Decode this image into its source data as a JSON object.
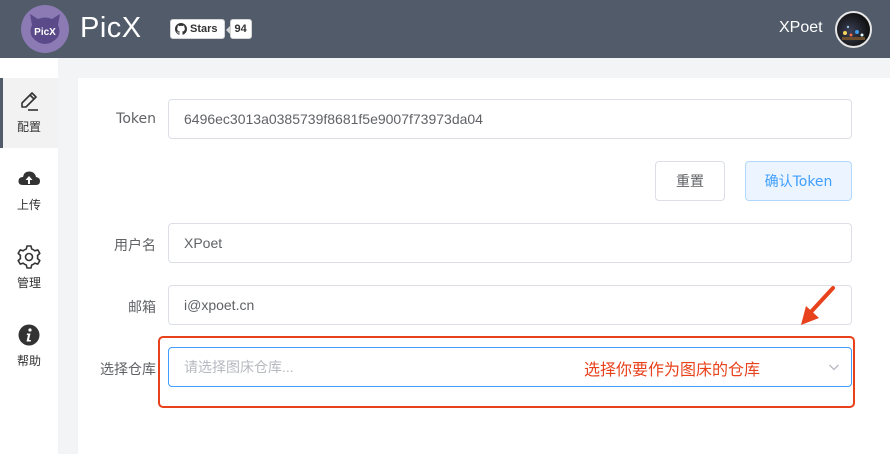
{
  "header": {
    "app_name": "PicX",
    "logo_text": "PicX",
    "stars_label": "Stars",
    "stars_count": "94",
    "username": "XPoet"
  },
  "sidebar": {
    "items": [
      {
        "label": "配置",
        "icon": "edit-pencil-icon",
        "active": true
      },
      {
        "label": "上传",
        "icon": "cloud-upload-icon",
        "active": false
      },
      {
        "label": "管理",
        "icon": "gear-icon",
        "active": false
      },
      {
        "label": "帮助",
        "icon": "info-icon",
        "active": false
      }
    ]
  },
  "form": {
    "token": {
      "label": "Token",
      "value": "6496ec3013a0385739f8681f5e9007f73973da04"
    },
    "buttons": {
      "reset": "重置",
      "confirm": "确认Token"
    },
    "username": {
      "label": "用户名",
      "value": "XPoet"
    },
    "email": {
      "label": "邮箱",
      "value": "i@xpoet.cn"
    },
    "repo": {
      "label": "选择仓库",
      "placeholder": "请选择图床仓库..."
    }
  },
  "annotation": {
    "text": "选择你要作为图床的仓库",
    "color": "#e8421c"
  },
  "colors": {
    "header_bg": "#515b6a",
    "primary": "#409eff",
    "logo_bg": "#8b7ab3"
  }
}
